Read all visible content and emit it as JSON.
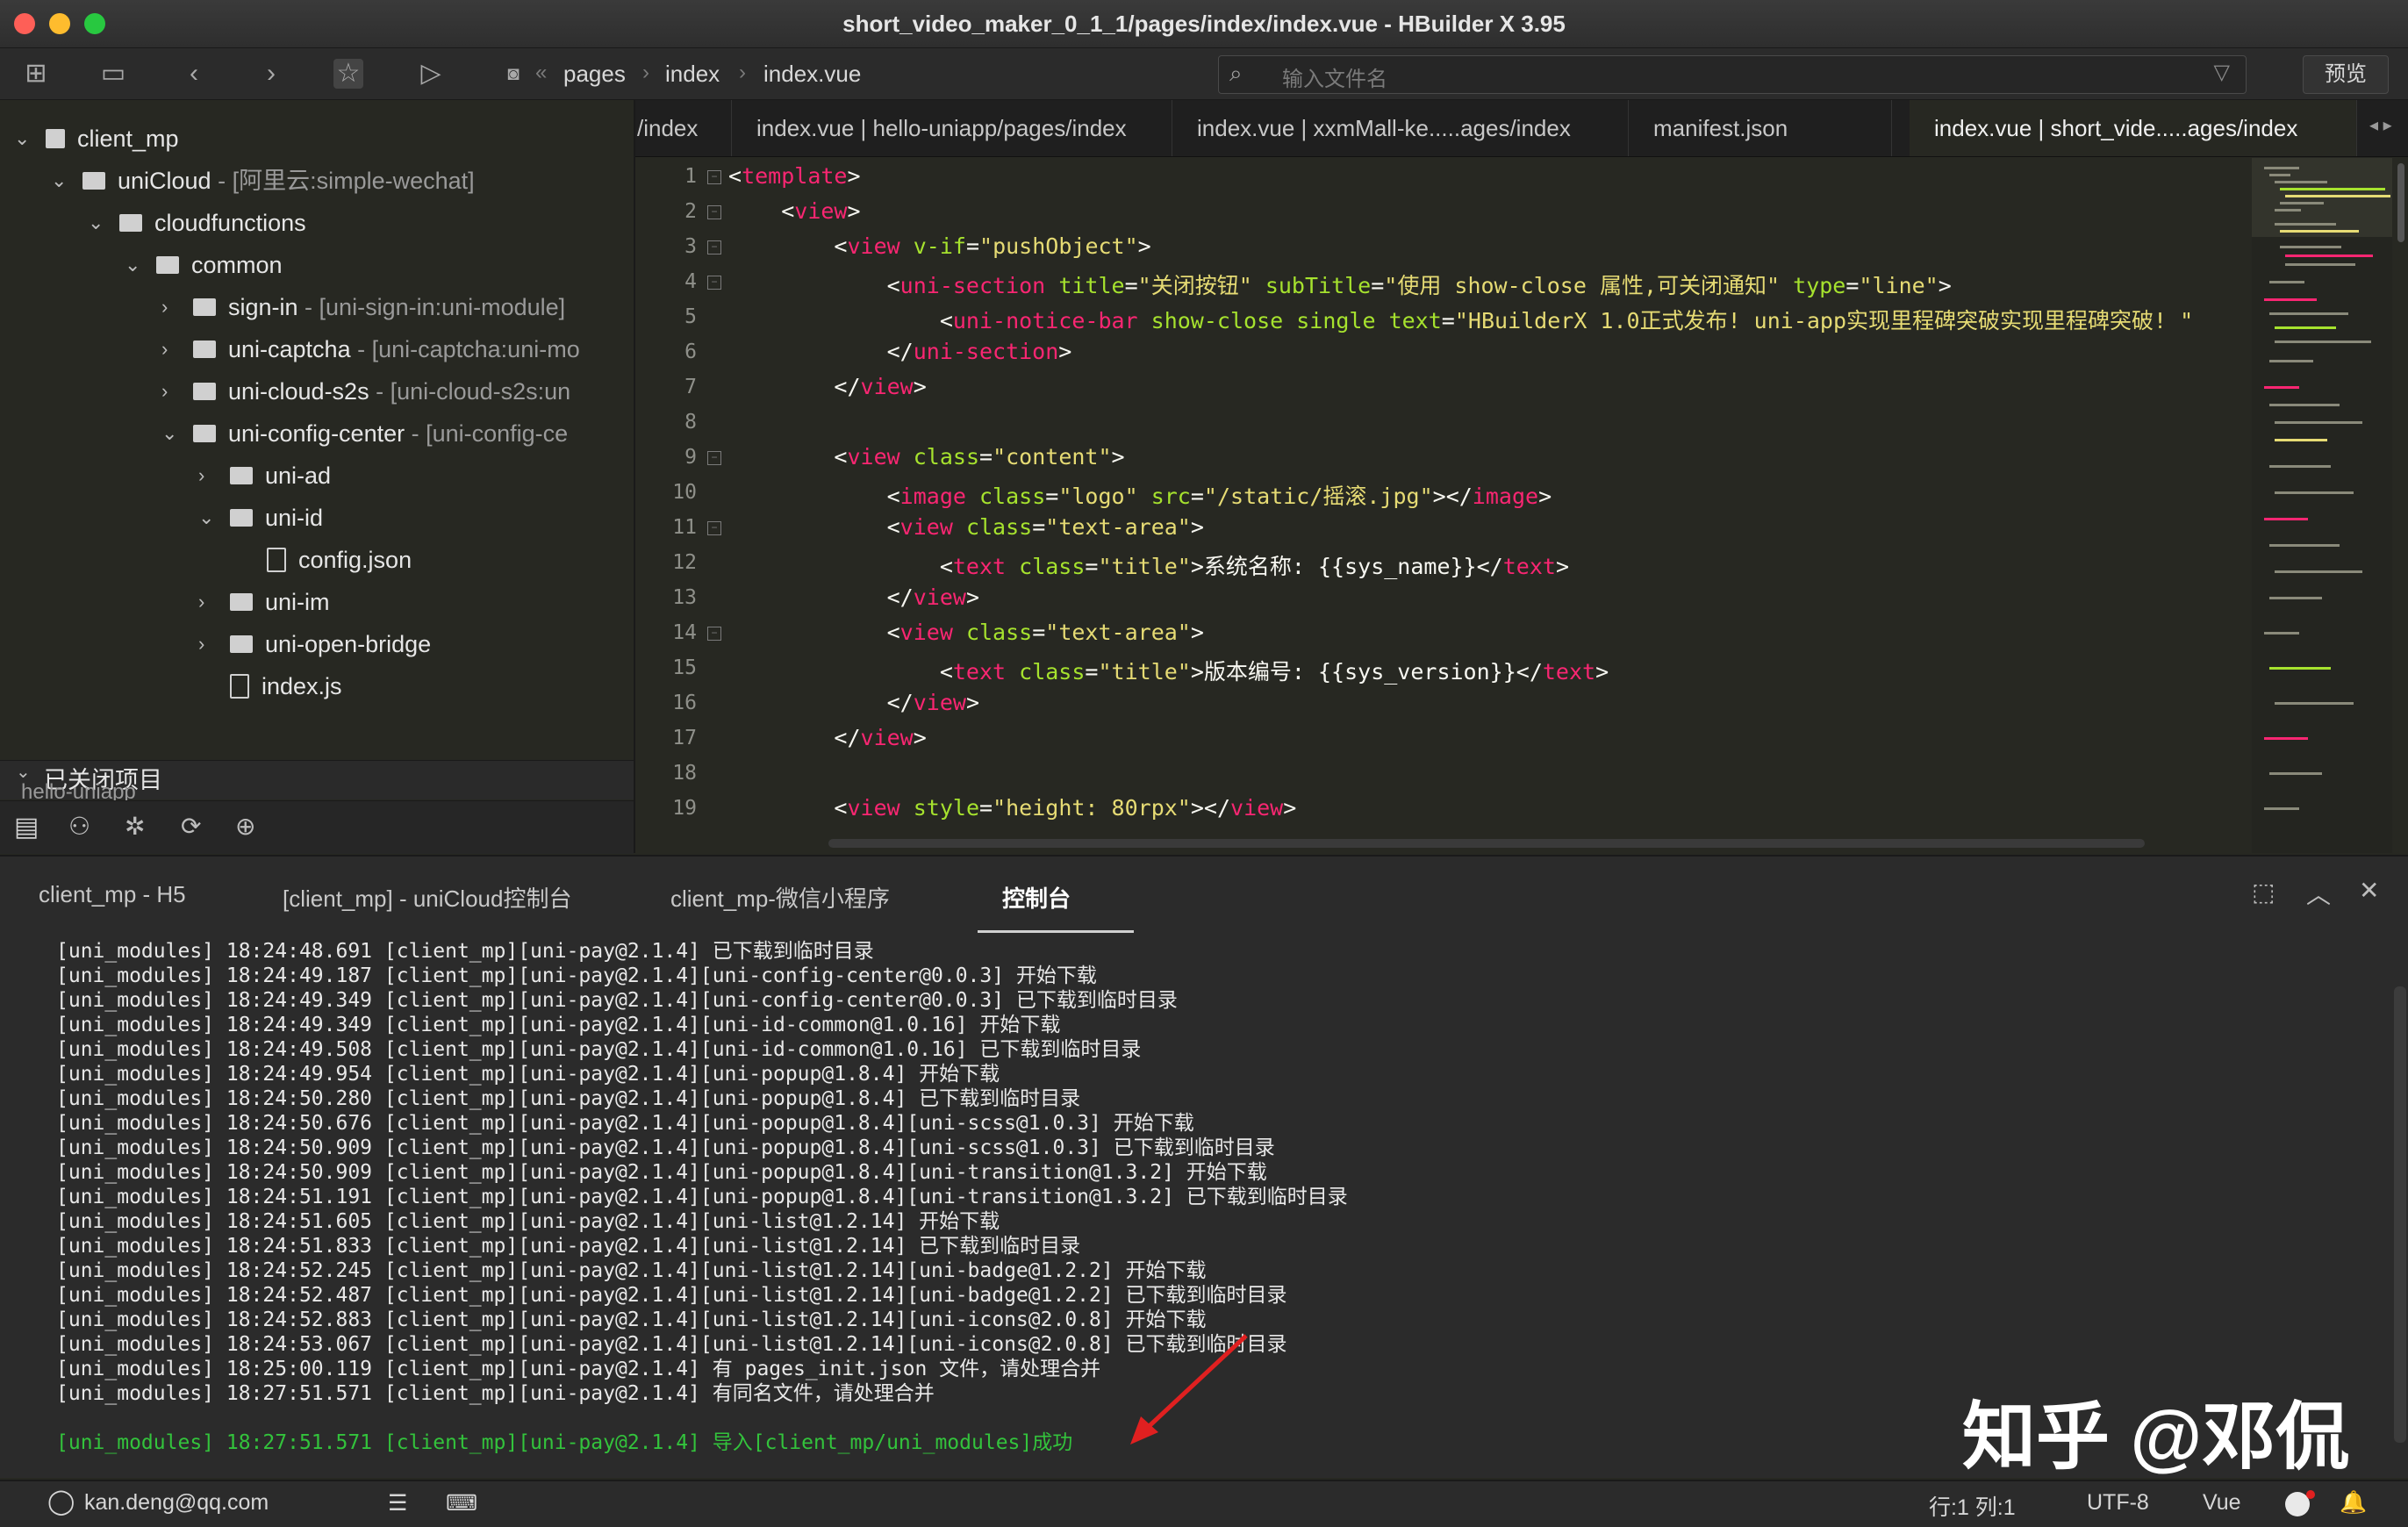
{
  "window": {
    "title": "short_video_maker_0_1_1/pages/index/index.vue - HBuilder X 3.95"
  },
  "toolbar": {
    "breadcrumb": [
      "pages",
      "index",
      "index.vue"
    ],
    "search_placeholder": "输入文件名",
    "preview_label": "预览"
  },
  "sidebar": {
    "items": [
      {
        "label": "client_mp",
        "desc": ""
      },
      {
        "label": "uniCloud",
        "desc": " - [阿里云:simple-wechat]"
      },
      {
        "label": "cloudfunctions",
        "desc": ""
      },
      {
        "label": "common",
        "desc": ""
      },
      {
        "label": "sign-in",
        "desc": " - [uni-sign-in:uni-module]"
      },
      {
        "label": "uni-captcha",
        "desc": " - [uni-captcha:uni-mo"
      },
      {
        "label": "uni-cloud-s2s",
        "desc": " - [uni-cloud-s2s:un"
      },
      {
        "label": "uni-config-center",
        "desc": " - [uni-config-ce"
      },
      {
        "label": "uni-ad",
        "desc": ""
      },
      {
        "label": "uni-id",
        "desc": ""
      },
      {
        "label": "config.json",
        "desc": ""
      },
      {
        "label": "uni-im",
        "desc": ""
      },
      {
        "label": "uni-open-bridge",
        "desc": ""
      },
      {
        "label": "index.js",
        "desc": ""
      }
    ],
    "closed_projects_label": "已关闭项目",
    "closed_project": "hello-uniapp"
  },
  "tabs": [
    {
      "label": "/index"
    },
    {
      "label": "index.vue | hello-uniapp/pages/index"
    },
    {
      "label": "index.vue | xxmMall-ke.....ages/index"
    },
    {
      "label": "manifest.json"
    },
    {
      "label": "index.vue | short_vide.....ages/index"
    }
  ],
  "editor": {
    "line_numbers": [
      "1",
      "2",
      "3",
      "4",
      "5",
      "6",
      "7",
      "8",
      "9",
      "10",
      "11",
      "12",
      "13",
      "14",
      "15",
      "16",
      "17",
      "18",
      "19"
    ]
  },
  "console": {
    "tabs": [
      "client_mp - H5",
      "[client_mp] - uniCloud控制台",
      "client_mp-微信小程序",
      "控制台"
    ],
    "lines": [
      "[uni_modules] 18:24:48.691 [client_mp][uni-pay@2.1.4] 已下载到临时目录",
      "[uni_modules] 18:24:49.187 [client_mp][uni-pay@2.1.4][uni-config-center@0.0.3] 开始下载",
      "[uni_modules] 18:24:49.349 [client_mp][uni-pay@2.1.4][uni-config-center@0.0.3] 已下载到临时目录",
      "[uni_modules] 18:24:49.349 [client_mp][uni-pay@2.1.4][uni-id-common@1.0.16] 开始下载",
      "[uni_modules] 18:24:49.508 [client_mp][uni-pay@2.1.4][uni-id-common@1.0.16] 已下载到临时目录",
      "[uni_modules] 18:24:49.954 [client_mp][uni-pay@2.1.4][uni-popup@1.8.4] 开始下载",
      "[uni_modules] 18:24:50.280 [client_mp][uni-pay@2.1.4][uni-popup@1.8.4] 已下载到临时目录",
      "[uni_modules] 18:24:50.676 [client_mp][uni-pay@2.1.4][uni-popup@1.8.4][uni-scss@1.0.3] 开始下载",
      "[uni_modules] 18:24:50.909 [client_mp][uni-pay@2.1.4][uni-popup@1.8.4][uni-scss@1.0.3] 已下载到临时目录",
      "[uni_modules] 18:24:50.909 [client_mp][uni-pay@2.1.4][uni-popup@1.8.4][uni-transition@1.3.2] 开始下载",
      "[uni_modules] 18:24:51.191 [client_mp][uni-pay@2.1.4][uni-popup@1.8.4][uni-transition@1.3.2] 已下载到临时目录",
      "[uni_modules] 18:24:51.605 [client_mp][uni-pay@2.1.4][uni-list@1.2.14] 开始下载",
      "[uni_modules] 18:24:51.833 [client_mp][uni-pay@2.1.4][uni-list@1.2.14] 已下载到临时目录",
      "[uni_modules] 18:24:52.245 [client_mp][uni-pay@2.1.4][uni-list@1.2.14][uni-badge@1.2.2] 开始下载",
      "[uni_modules] 18:24:52.487 [client_mp][uni-pay@2.1.4][uni-list@1.2.14][uni-badge@1.2.2] 已下载到临时目录",
      "[uni_modules] 18:24:52.883 [client_mp][uni-pay@2.1.4][uni-list@1.2.14][uni-icons@2.0.8] 开始下载",
      "[uni_modules] 18:24:53.067 [client_mp][uni-pay@2.1.4][uni-list@1.2.14][uni-icons@2.0.8] 已下载到临时目录",
      "[uni_modules] 18:25:00.119 [client_mp][uni-pay@2.1.4] 有 pages_init.json 文件，请处理合并",
      "[uni_modules] 18:27:51.571 [client_mp][uni-pay@2.1.4] 有同名文件，请处理合并"
    ],
    "success_line": "[uni_modules] 18:27:51.571 [client_mp][uni-pay@2.1.4] 导入[client_mp/uni_modules]成功"
  },
  "watermark": "知乎 @邓侃",
  "statusbar": {
    "user": "kan.deng@qq.com",
    "position": "行:1  列:1",
    "encoding": "UTF-8",
    "language": "Vue"
  },
  "colors": {
    "tag": "#f92672",
    "attr": "#a6e22e",
    "string": "#e6db74",
    "success": "#33c33c",
    "arrow": "#e02020"
  }
}
